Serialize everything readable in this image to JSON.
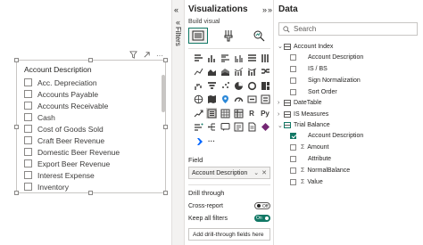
{
  "slicer": {
    "title": "Account Description",
    "items": [
      "Acc. Depreciation",
      "Accounts Payable",
      "Accounts Receivable",
      "Cash",
      "Cost of Goods Sold",
      "Craft Beer Revenue",
      "Domestic Beer Revenue",
      "Export Beer Revenue",
      "Interest Expense",
      "Inventory"
    ],
    "toolbar_icons": [
      "filter-icon",
      "focus-mode-icon",
      "more-options-icon"
    ],
    "more_label": "···"
  },
  "filters": {
    "label": "Filters",
    "chevron": "«"
  },
  "visualizations": {
    "title": "Visualizations",
    "collapse_chevron": "»",
    "expand_chevron": "«",
    "build_label": "Build visual",
    "build_icons": [
      "build-visual-icon",
      "format-visual-icon",
      "analytics-icon"
    ],
    "icon_rows": [
      [
        "stacked-bar-chart-icon",
        "stacked-column-chart-icon",
        "clustered-bar-chart-icon",
        "clustered-column-chart-icon",
        "100-stacked-bar-chart-icon",
        "100-stacked-column-chart-icon"
      ],
      [
        "line-chart-icon",
        "area-chart-icon",
        "stacked-area-chart-icon",
        "line-clustered-column-chart-icon",
        "line-stacked-column-chart-icon",
        "ribbon-chart-icon"
      ],
      [
        "waterfall-chart-icon",
        "funnel-chart-icon",
        "scatter-chart-icon",
        "pie-chart-icon",
        "donut-chart-icon",
        "treemap-icon"
      ],
      [
        "map-icon",
        "filled-map-icon",
        "azure-map-icon",
        "gauge-icon",
        "card-icon",
        "multi-row-card-icon"
      ],
      [
        "kpi-icon",
        "slicer-icon",
        "table-icon",
        "matrix-icon",
        "r-visual-icon",
        "python-visual-icon"
      ],
      [
        "key-influencers-icon",
        "decomposition-tree-icon",
        "qa-icon",
        "smart-narrative-icon",
        "paginated-report-icon",
        "power-apps-icon"
      ],
      [
        "power-automate-icon",
        "more-visuals-icon"
      ]
    ],
    "r_glyph": "R",
    "py_glyph": "Py",
    "more_glyph": "···",
    "field_label": "Field",
    "field_value": "Account Description",
    "field_remove": "✕",
    "field_dropdown": "⌄",
    "drill_title": "Drill through",
    "cross_report_label": "Cross-report",
    "cross_report_state": "Off",
    "keep_filters_label": "Keep all filters",
    "keep_filters_state": "On",
    "add_drill_label": "Add drill-through fields here"
  },
  "data": {
    "title": "Data",
    "collapse_chevron": "»",
    "search_placeholder": "Search",
    "tables": [
      {
        "name": "Account Index",
        "expanded": true,
        "fields": [
          {
            "name": "Account Description",
            "checked": false,
            "measure": false
          },
          {
            "name": "IS / BS",
            "checked": false,
            "measure": false
          },
          {
            "name": "Sign Normalization",
            "checked": false,
            "measure": false
          },
          {
            "name": "Sort Order",
            "checked": false,
            "measure": false
          }
        ]
      },
      {
        "name": "DateTable",
        "expanded": false,
        "fields": []
      },
      {
        "name": "IS Measures",
        "expanded": false,
        "fields": []
      },
      {
        "name": "Trial Balance",
        "expanded": true,
        "fields": [
          {
            "name": "Account Description",
            "checked": true,
            "measure": false
          },
          {
            "name": "Amount",
            "checked": false,
            "measure": true
          },
          {
            "name": "Attribute",
            "checked": false,
            "measure": false
          },
          {
            "name": "NormalBalance",
            "checked": false,
            "measure": true
          },
          {
            "name": "Value",
            "checked": false,
            "measure": true
          }
        ]
      }
    ]
  },
  "colors": {
    "accent": "#117865",
    "border": "#c8c6c4",
    "pane_bg": "#f3f2f1"
  }
}
